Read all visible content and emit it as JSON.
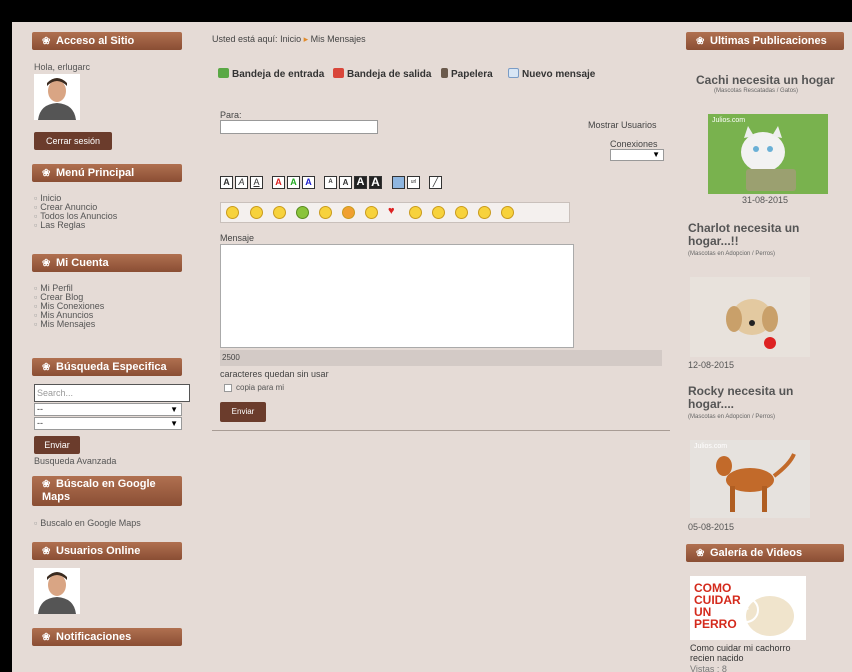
{
  "left": {
    "acceso_title": "Acceso al Sitio",
    "greeting": "Hola, erlugarc",
    "logout_label": "Cerrar sesión",
    "menu_title": "Menú Principal",
    "menu_items": [
      "Inicio",
      "Crear Anuncio",
      "Todos los Anuncios",
      "Las Reglas"
    ],
    "cuenta_title": "Mi Cuenta",
    "cuenta_items": [
      "Mi Perfil",
      "Crear Blog",
      "Mis Conexiones",
      "Mis Anuncios",
      "Mis Mensajes"
    ],
    "busqueda_title": "Búsqueda Especifica",
    "search_placeholder": "Search...",
    "select1_value": "--",
    "select2_value": "--",
    "enviar_label": "Enviar",
    "busqueda_avanzada": "Busqueda Avanzada",
    "maps_title": "Búscalo en Google Maps",
    "maps_items": [
      "Buscalo en Google Maps"
    ],
    "online_title": "Usuarios Online",
    "notif_title": "Notificaciones"
  },
  "main": {
    "breadcrumb_prefix": "Usted está aquí:",
    "breadcrumb_home": "Inicio",
    "breadcrumb_current": "Mis Mensajes",
    "tabs": [
      "Bandeja de entrada",
      "Bandeja de salida",
      "Papelera",
      "Nuevo mensaje"
    ],
    "para_label": "Para:",
    "mostrar_usuarios": "Mostrar Usuarios",
    "conexiones_label": "Conexiones",
    "mensaje_label": "Mensaje",
    "counter_value": "2500",
    "counter_text": "caracteres quedan sin usar",
    "copia_label": "copia para mi",
    "enviar_label": "Enviar"
  },
  "right": {
    "publicaciones_title": "Ultimas Publicaciones",
    "posts": [
      {
        "title": "Cachi necesita un hogar",
        "sub": "(Mascotas Rescatadas / Gatos)",
        "date": "31-08-2015",
        "thumb_label": "Julios.com"
      },
      {
        "title": "Charlot necesita un hogar...!!",
        "sub": "(Mascotas en Adopcion / Perros)",
        "date": "12-08-2015"
      },
      {
        "title": "Rocky necesita un hogar....",
        "sub": "(Mascotas en Adopcion / Perros)",
        "date": "05-08-2015",
        "thumb_label": "Julios.com"
      }
    ],
    "videos_title": "Galería de Videos",
    "video_thumb_text": "COMO CUIDAR UN PERRO",
    "video_caption": "Como cuidar mi cachorro recien nacido",
    "video_views": "Vistas : 8"
  },
  "colors": {
    "header_bg": "#8a4e34",
    "page_bg": "#e5dbd6",
    "button_bg": "#6b3c2c"
  }
}
